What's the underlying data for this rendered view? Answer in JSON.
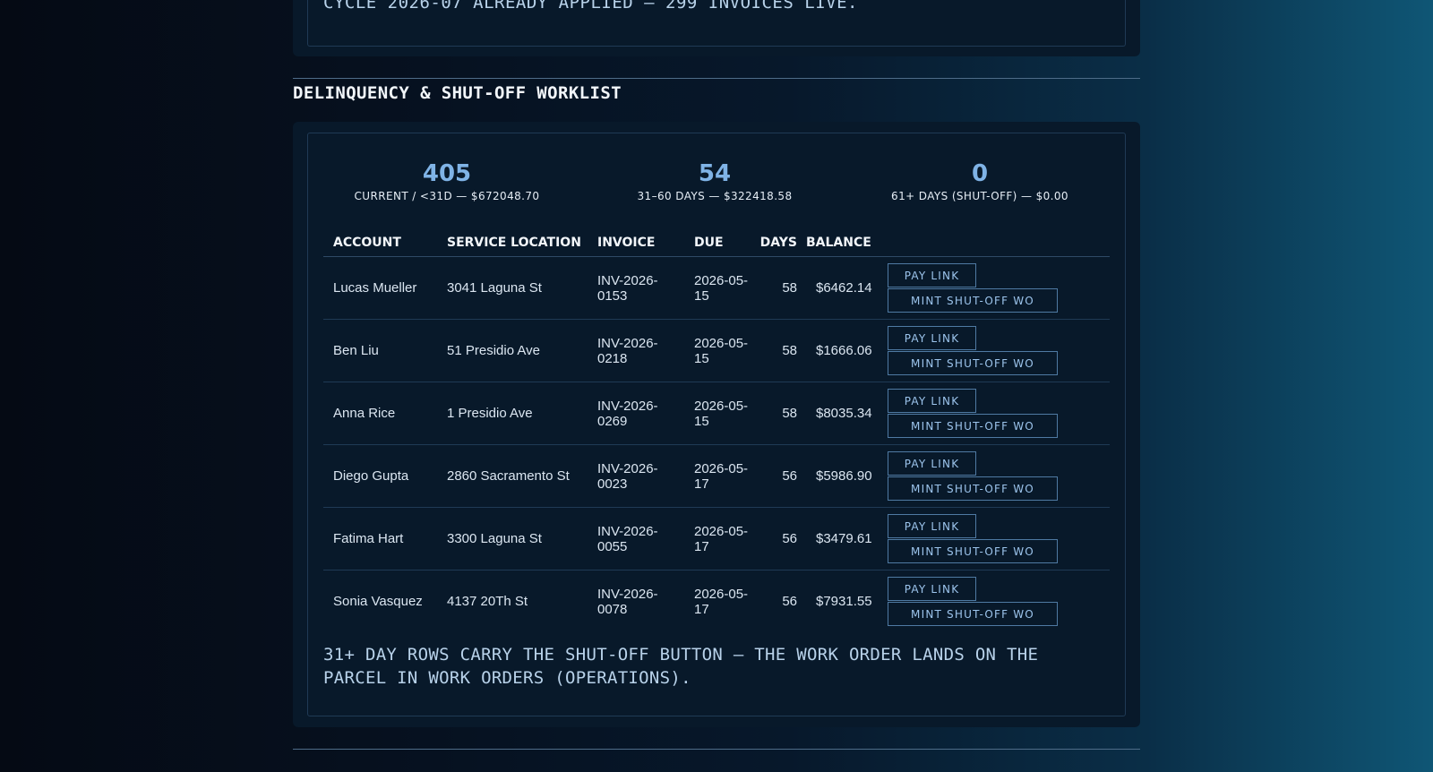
{
  "top_card": {
    "note": "CYCLE 2026-07 ALREADY APPLIED — 299 INVOICES LIVE."
  },
  "section": {
    "title": "DELINQUENCY & SHUT-OFF WORKLIST"
  },
  "stats": [
    {
      "value": "405",
      "label": "CURRENT / <31D — $672048.70"
    },
    {
      "value": "54",
      "label": "31–60 DAYS — $322418.58"
    },
    {
      "value": "0",
      "label": "61+ DAYS (SHUT-OFF) — $0.00"
    }
  ],
  "table": {
    "headers": {
      "account": "ACCOUNT",
      "location": "SERVICE LOCATION",
      "invoice": "INVOICE",
      "due": "DUE",
      "days": "DAYS",
      "balance": "BALANCE"
    },
    "pay_label": "PAY LINK",
    "mint_label": "MINT SHUT-OFF WO",
    "rows": [
      {
        "account": "Lucas Mueller",
        "location": "3041 Laguna St",
        "invoice": "INV-2026-0153",
        "due": "2026-05-15",
        "days": "58",
        "balance": "$6462.14"
      },
      {
        "account": "Ben Liu",
        "location": "51 Presidio Ave",
        "invoice": "INV-2026-0218",
        "due": "2026-05-15",
        "days": "58",
        "balance": "$1666.06"
      },
      {
        "account": "Anna Rice",
        "location": "1 Presidio Ave",
        "invoice": "INV-2026-0269",
        "due": "2026-05-15",
        "days": "58",
        "balance": "$8035.34"
      },
      {
        "account": "Diego Gupta",
        "location": "2860 Sacramento St",
        "invoice": "INV-2026-0023",
        "due": "2026-05-17",
        "days": "56",
        "balance": "$5986.90"
      },
      {
        "account": "Fatima Hart",
        "location": "3300 Laguna St",
        "invoice": "INV-2026-0055",
        "due": "2026-05-17",
        "days": "56",
        "balance": "$3479.61"
      },
      {
        "account": "Sonia Vasquez",
        "location": "4137 20Th St",
        "invoice": "INV-2026-0078",
        "due": "2026-05-17",
        "days": "56",
        "balance": "$7931.55"
      }
    ]
  },
  "footer_note": "31+ DAY ROWS CARRY THE SHUT-OFF BUTTON — THE WORK ORDER LANDS ON THE PARCEL IN WORK ORDERS (OPERATIONS)."
}
